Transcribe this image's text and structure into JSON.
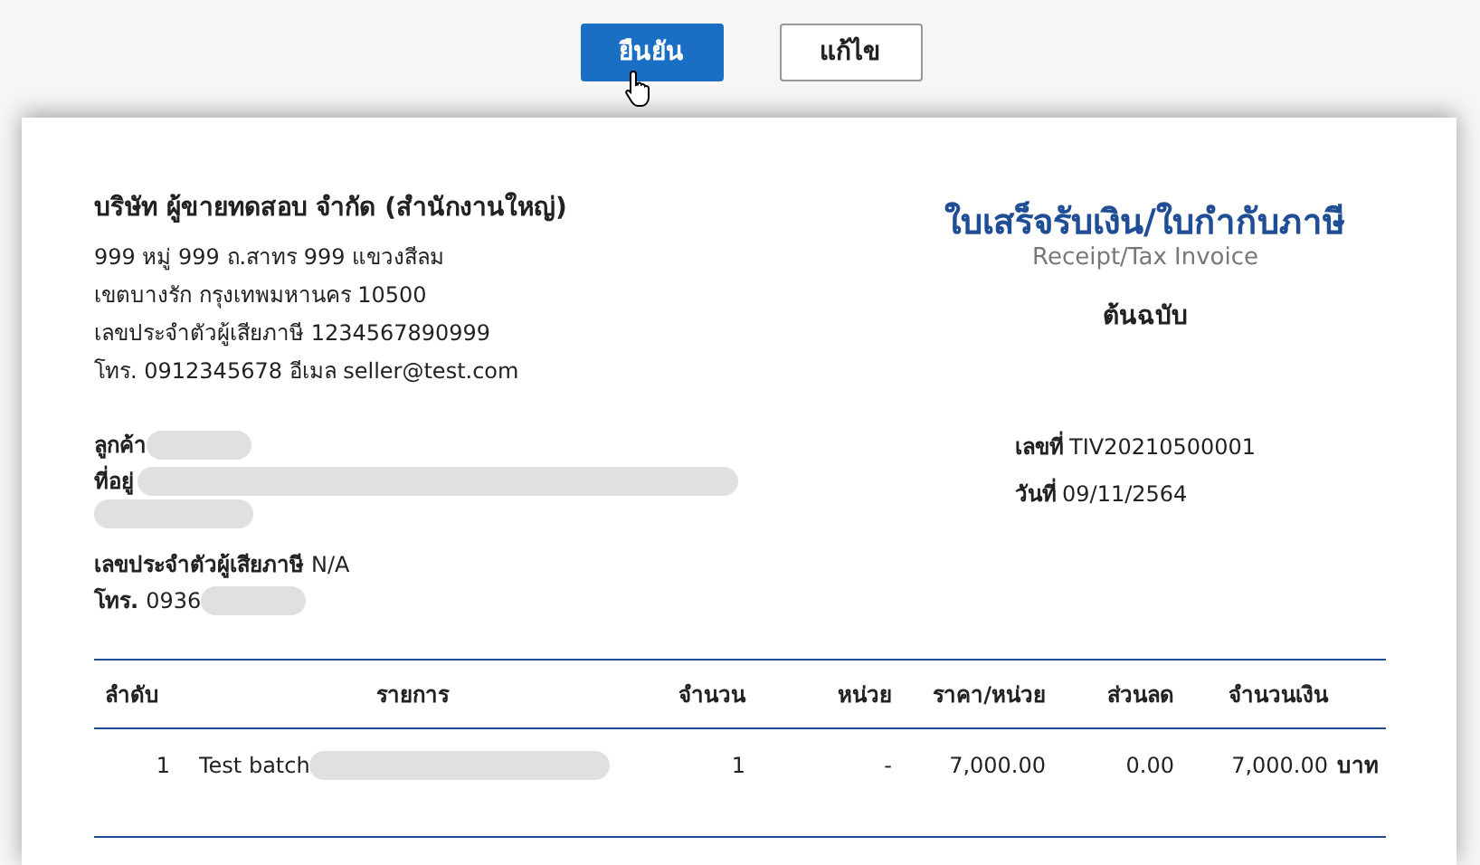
{
  "actions": [
    {
      "label": "ยืนยัน",
      "kind": "primary"
    },
    {
      "label": "แก้ไข",
      "kind": "secondary"
    }
  ],
  "seller": {
    "name": "บริษัท ผู้ขายทดสอบ จำกัด (สำนักงานใหญ่)",
    "lines": [
      "999 หมู่ 999 ถ.สาทร 999 แขวงสีลม",
      "เขตบางรัก  กรุงเทพมหานคร 10500",
      "เลขประจำตัวผู้เสียภาษี 1234567890999",
      "โทร. 0912345678  อีเมล seller@test.com"
    ]
  },
  "document": {
    "title": "ใบเสร็จรับเงิน/ใบกำกับภาษี",
    "subtitle": "Receipt/Tax Invoice",
    "copy": "ต้นฉบับ"
  },
  "customer": [
    {
      "label": "ลูกค้า",
      "redacted": true
    },
    {
      "label": "ที่อยู่",
      "redacted": true
    },
    {
      "label": "เลขประจำตัวผู้เสียภาษี",
      "value": "N/A",
      "redacted": false
    },
    {
      "label": "โทร.",
      "value": "0936",
      "redacted": true
    }
  ],
  "meta": [
    {
      "label": "เลขที่",
      "value": "TIV20210500001"
    },
    {
      "label": "วันที่",
      "value": "09/11/2564"
    }
  ],
  "table": {
    "columns": [
      "ลำดับ",
      "รายการ",
      "จำนวน",
      "หน่วย",
      "ราคา/หน่วย",
      "ส่วนลด",
      "จำนวนเงิน"
    ],
    "rows": [
      {
        "cells": [
          "1",
          "Test batch",
          "1",
          "-",
          "7,000.00",
          "0.00",
          "7,000.00"
        ],
        "currency": "บาท",
        "redacted": true
      }
    ]
  }
}
